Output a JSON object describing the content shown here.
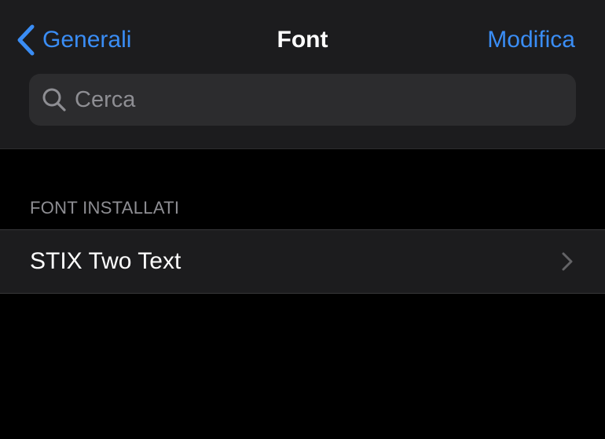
{
  "navbar": {
    "back_label": "Generali",
    "title": "Font",
    "edit_label": "Modifica"
  },
  "search": {
    "placeholder": "Cerca",
    "value": ""
  },
  "installed_section": {
    "header": "FONT INSTALLATI",
    "items": [
      {
        "label": "STIX Two Text"
      }
    ]
  },
  "icons": {
    "back": "chevron-left-icon",
    "search": "magnifying-glass-icon",
    "disclosure": "chevron-right-icon"
  },
  "colors": {
    "accent": "#3a8df5",
    "background": "#000000",
    "surface": "#1c1c1e",
    "search_field": "#2c2c2e",
    "secondary_text": "#8e8e93",
    "primary_text": "#ffffff"
  }
}
